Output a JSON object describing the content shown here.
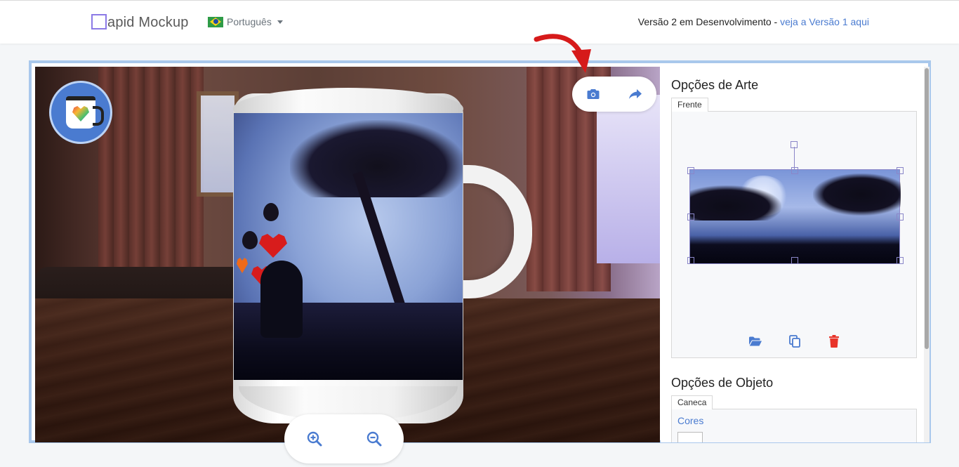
{
  "navbar": {
    "brand": "apid Mockup",
    "language": "Português",
    "version_text": "Versão 2 em Desenvolvimento - ",
    "version_link": "veja a Versão 1 aqui"
  },
  "viewer": {
    "camera_icon": "camera-icon",
    "share_icon": "share-icon",
    "zoom_in_icon": "zoom-in-icon",
    "zoom_out_icon": "zoom-out-icon"
  },
  "art_options": {
    "title": "Opções de Arte",
    "tab": "Frente",
    "tools": [
      "folder-open-icon",
      "copy-icon",
      "trash-icon"
    ]
  },
  "object_options": {
    "title": "Opções de Objeto",
    "tab": "Caneca",
    "colors_link": "Cores"
  },
  "colors": {
    "accent": "#4a7bd0",
    "frame": "#a9c8ec",
    "delete": "#e8342a",
    "annotation_arrow": "#d61a1a"
  }
}
